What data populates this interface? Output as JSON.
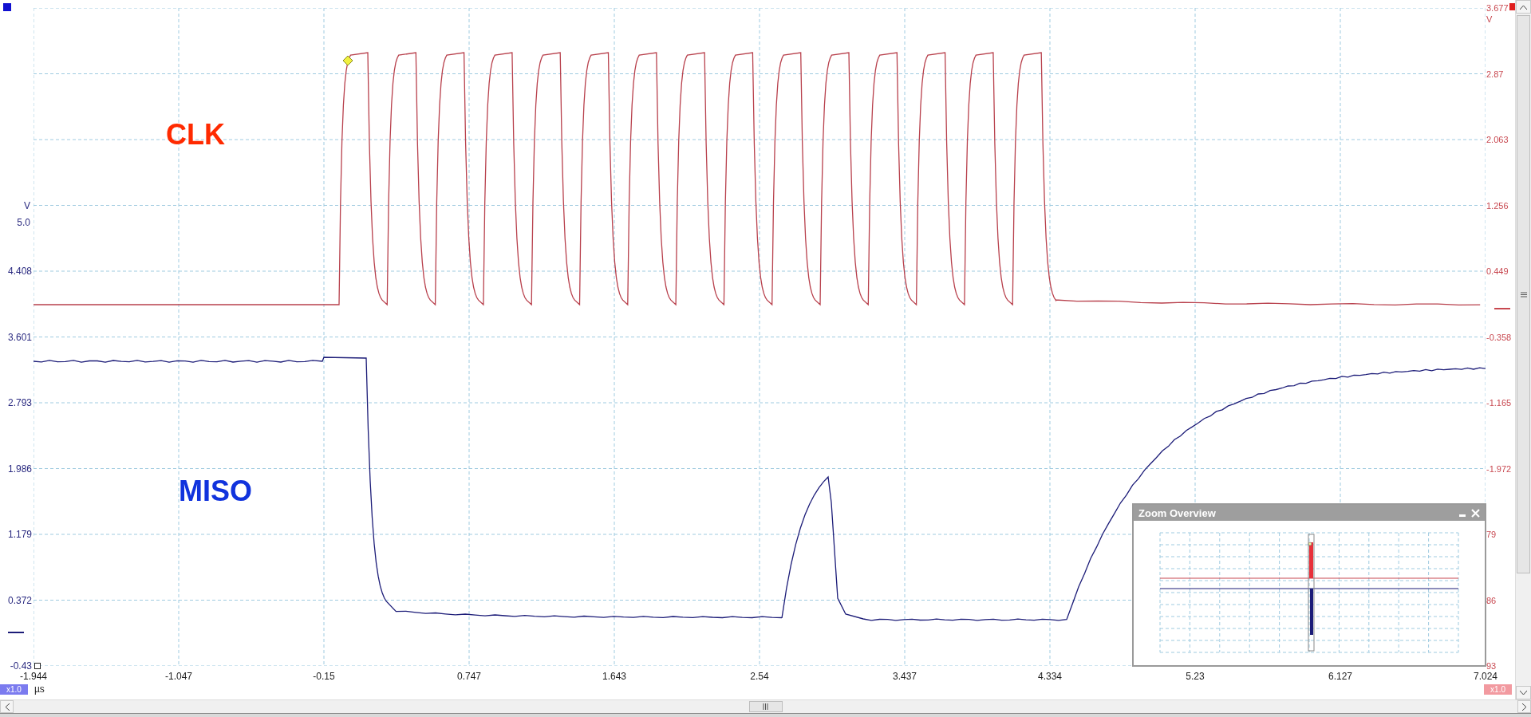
{
  "signal_labels": [
    {
      "text": "CLK",
      "color": "#ff2a00"
    },
    {
      "text": "MISO",
      "color": "#1133dd"
    }
  ],
  "left_axis": {
    "unit": "V",
    "labels": [
      "5.0",
      "4.408",
      "3.601",
      "2.793",
      "1.986",
      "1.179",
      "0.372",
      "-0.43"
    ]
  },
  "right_axis": {
    "unit": "V",
    "labels": [
      "3.677",
      "2.87",
      "2.063",
      "1.256",
      "0.449",
      "-0.358",
      "-1.165",
      "-1.972",
      "79",
      "86",
      "93"
    ]
  },
  "x_axis": {
    "labels": [
      "-1.944",
      "-1.047",
      "-0.15",
      "0.747",
      "1.643",
      "2.54",
      "3.437",
      "4.334",
      "5.23",
      "6.127",
      "7.024"
    ],
    "unit": "µs",
    "left_zoom": "x1.0",
    "right_zoom": "x1.0"
  },
  "zoom_overview": {
    "title": "Zoom Overview"
  }
}
